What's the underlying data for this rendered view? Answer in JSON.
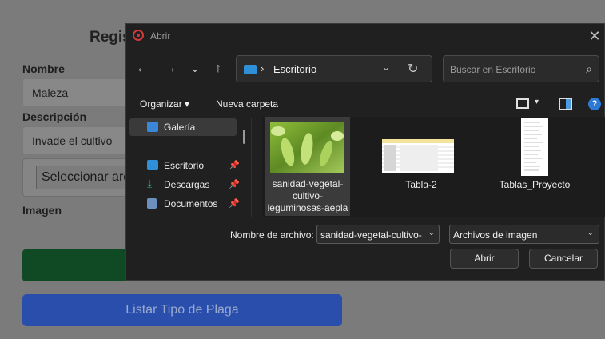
{
  "background_form": {
    "title": "Regis",
    "name_label": "Nombre",
    "name_value": "Maleza",
    "desc_label": "Descripción",
    "desc_value": "Invade el cultivo",
    "file_button": "Seleccionar arc",
    "image_label": "Imagen",
    "list_button": "Listar Tipo de Plaga"
  },
  "dialog": {
    "title": "Abrir",
    "close": "✕",
    "nav": {
      "back": "←",
      "forward": "→",
      "recent": "⌄",
      "up": "↑",
      "address_sep": "›",
      "address": "Escritorio",
      "address_chevron": "⌄",
      "refresh": "↻",
      "search_placeholder": "Buscar en Escritorio",
      "search_icon": "⌕"
    },
    "toolbar": {
      "organize": "Organizar ▾",
      "new_folder": "Nueva carpeta",
      "view_chevron": "▾",
      "help": "?"
    },
    "sidebar": [
      {
        "label": "Galería",
        "icon": "gallery-icon",
        "color": "#3a86d8",
        "pinned": false,
        "selected": true
      },
      {
        "label": "Escritorio",
        "icon": "desktop-icon",
        "color": "#2f8fd8",
        "pinned": true,
        "selected": false
      },
      {
        "label": "Descargas",
        "icon": "download-icon",
        "color": "#2db7a0",
        "pinned": true,
        "selected": false
      },
      {
        "label": "Documentos",
        "icon": "documents-icon",
        "color": "#6c8fbf",
        "pinned": true,
        "selected": false
      }
    ],
    "pin_glyph": "📌",
    "files": [
      {
        "name": "sanidad-vegetal-cultivo-leguminosas-aepla",
        "thumb": "pea-pods-photo",
        "selected": true
      },
      {
        "name": "Tabla-2",
        "thumb": "spreadsheet-thumb",
        "selected": false
      },
      {
        "name": "Tablas_Proyecto",
        "thumb": "document-thumb",
        "selected": false
      }
    ],
    "filename_label": "Nombre de archivo:",
    "filename_value": "sanidad-vegetal-cultivo-",
    "filetype_value": "Archivos de imagen",
    "open_button": "Abrir",
    "cancel_button": "Cancelar"
  }
}
